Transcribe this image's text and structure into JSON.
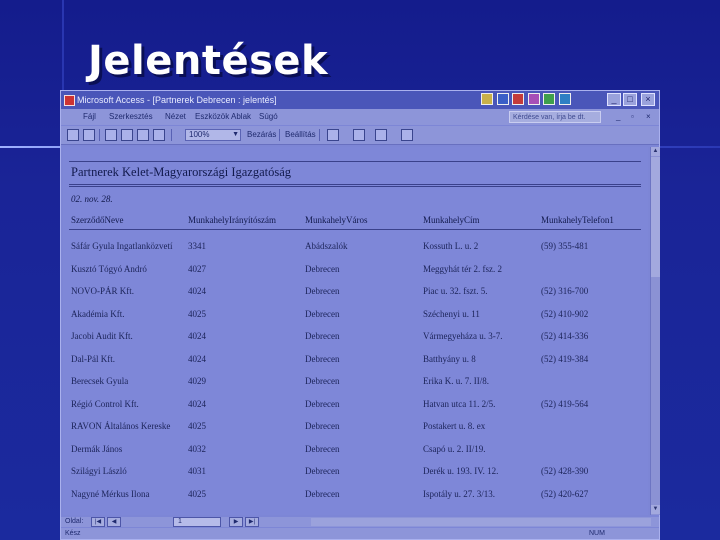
{
  "slide": {
    "title": "Jelentések"
  },
  "window": {
    "title": "Microsoft Access - [Partnerek Debrecen : jelentés]",
    "minimize_label": "_",
    "restore_label": "□",
    "close_label": "×"
  },
  "menu": {
    "items": [
      "Fájl",
      "Szerkesztés",
      "Nézet",
      "Eszközök",
      "Ablak",
      "Súgó"
    ],
    "help_placeholder": "Kérdése van, írja be dt."
  },
  "toolbar": {
    "zoom_value": "100%",
    "close_label": "Bezárás",
    "setup_label": "Beállítás"
  },
  "report": {
    "title": "Partnerek Kelet-Magyarországi Igazgatóság",
    "date": "02. nov. 28.",
    "columns": [
      "SzerződőNeve",
      "MunkahelyIrányítószám",
      "MunkahelyVáros",
      "MunkahelyCím",
      "MunkahelyTelefon1"
    ],
    "rows": [
      [
        "Sáfár Gyula Ingatlanközvetí",
        "3341",
        "Abádszalók",
        "Kossuth L. u. 2",
        "(59) 355-481"
      ],
      [
        "Kusztó Tógyó Andró",
        "4027",
        "Debrecen",
        "Meggyhát tér 2. fsz. 2",
        ""
      ],
      [
        "NOVO-PÁR Kft.",
        "4024",
        "Debrecen",
        "Piac u. 32. fszt. 5.",
        "(52) 316-700"
      ],
      [
        "Akadémia Kft.",
        "4025",
        "Debrecen",
        "Széchenyi u. 11",
        "(52) 410-902"
      ],
      [
        "Jacobi Audit Kft.",
        "4024",
        "Debrecen",
        "Vármegyeháza u. 3-7.",
        "(52) 414-336"
      ],
      [
        "Dal-Pál Kft.",
        "4024",
        "Debrecen",
        "Batthyány u. 8",
        "(52) 419-384"
      ],
      [
        "Berecsek Gyula",
        "4029",
        "Debrecen",
        "Erika K. u. 7. II/8.",
        ""
      ],
      [
        "Régió Control Kft.",
        "4024",
        "Debrecen",
        "Hatvan utca 11. 2/5.",
        "(52) 419-564"
      ],
      [
        "RAVON Általános Kereske",
        "4025",
        "Debrecen",
        "Postakert u. 8. ex",
        ""
      ],
      [
        "Dermák János",
        "4032",
        "Debrecen",
        "Csapó u. 2. II/19.",
        ""
      ],
      [
        "Szilágyi László",
        "4031",
        "Debrecen",
        "Derék u. 193. IV. 12.",
        "(52) 428-390"
      ],
      [
        "Nagyné Mérkus Ilona",
        "4025",
        "Debrecen",
        "Ispotály u. 27. 3/13.",
        "(52) 420-627"
      ]
    ]
  },
  "navigation": {
    "label": "Oldal:",
    "first": "|◀",
    "prev": "◀",
    "page": "1",
    "next": "▶",
    "last": "▶|"
  },
  "status": {
    "left": "Kész",
    "right": "NUM"
  },
  "colors": {
    "background": "#1a2497",
    "window": "#7d86d6",
    "title": "#ffffff"
  }
}
